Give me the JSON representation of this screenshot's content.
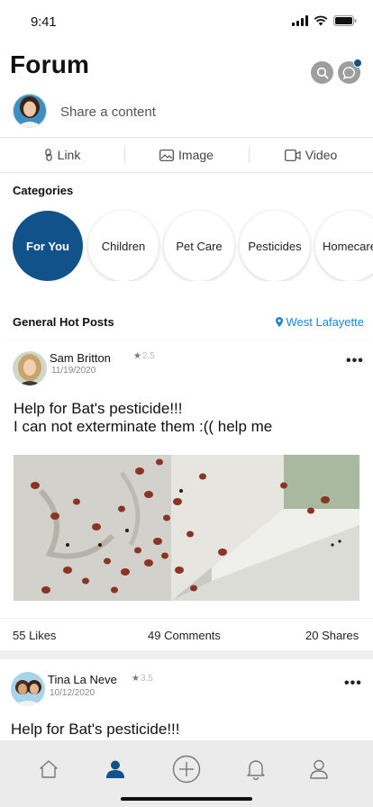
{
  "status": {
    "time": "9:41"
  },
  "header": {
    "title": "Forum",
    "search_icon": "search-icon",
    "chat_icon": "chat-icon",
    "accent_color": "#12528a"
  },
  "composer": {
    "placeholder": "Share a content"
  },
  "media": [
    {
      "label": "Link",
      "icon": "link-icon"
    },
    {
      "label": "Image",
      "icon": "image-icon"
    },
    {
      "label": "Video",
      "icon": "video-icon"
    }
  ],
  "categories": {
    "title": "Categories",
    "items": [
      {
        "label": "For You",
        "active": true
      },
      {
        "label": "Children",
        "active": false
      },
      {
        "label": "Pet Care",
        "active": false
      },
      {
        "label": "Pesticides",
        "active": false
      },
      {
        "label": "Homecare",
        "active": false
      }
    ]
  },
  "hot_posts": {
    "title": "General Hot Posts",
    "location": "West Lafayette",
    "location_color": "#1e86d6"
  },
  "posts": [
    {
      "author": "Sam Britton",
      "rating": "2.5",
      "date": "11/19/2020",
      "text_line1": "Help for Bat's pesticide!!!",
      "text_line2": "I can not exterminate them :(( help me",
      "likes": "55 Likes",
      "comments": "49 Comments",
      "shares": "20 Shares"
    },
    {
      "author": "Tina La Neve",
      "rating": "3.5",
      "date": "10/12/2020",
      "text_line1": "Help for Bat's pesticide!!!"
    }
  ],
  "more_label": "•••",
  "tabs": [
    "home-icon",
    "community-icon",
    "add-icon",
    "bell-icon",
    "profile-icon"
  ]
}
